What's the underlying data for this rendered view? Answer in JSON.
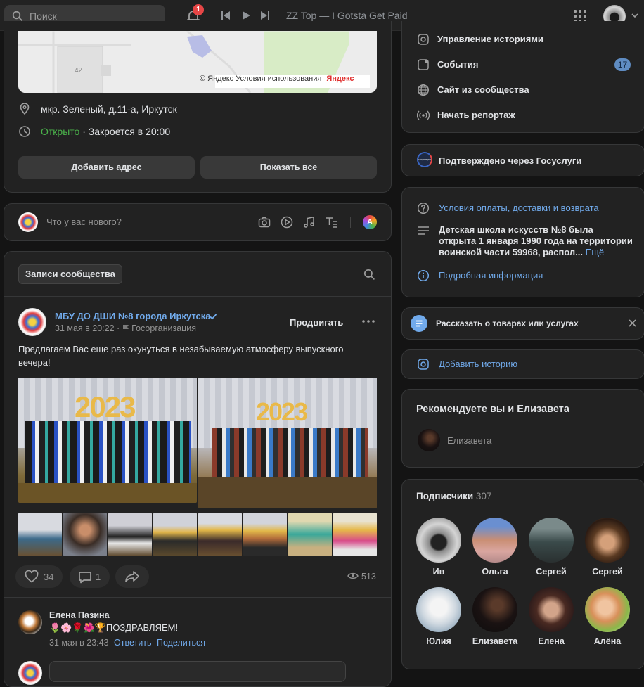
{
  "topbar": {
    "search_placeholder": "Поиск",
    "notifications_count": "1",
    "now_playing": "ZZ Top — I Gotsta Get Paid"
  },
  "map": {
    "house_number": "42",
    "copyright": "© Яндекс",
    "terms_link": "Условия использования",
    "brand": "Яндекс"
  },
  "info": {
    "address": "мкр. Зеленый, д.11-а, Иркутск",
    "open_status": "Открыто",
    "closes": " · Закроется в 20:00",
    "add_address_btn": "Добавить адрес",
    "show_all_btn": "Показать все"
  },
  "composer": {
    "placeholder": "Что у вас нового?"
  },
  "wall": {
    "tab_label": "Записи сообщества"
  },
  "post": {
    "author": "МБУ ДО ДШИ №8 города Иркутска",
    "date": "31 мая в 20:22",
    "author_type": "Госорганизация",
    "promote_btn": "Продвигать",
    "text": "Предлагаем Вас еще раз окунуться в незабываемую атмосферу выпускного вечера!",
    "photo_caption": "2023",
    "likes": "34",
    "comments": "1",
    "views": "513"
  },
  "comment": {
    "author": "Елена Пазина",
    "text": "🌷🌸🌹🌺🏆ПОЗДРАВЛЯЕМ!",
    "date": "31 мая в 23:43",
    "reply": "Ответить",
    "share": "Поделиться"
  },
  "side_menu": {
    "items": [
      {
        "label": "Управление историями",
        "icon": "stories-icon"
      },
      {
        "label": "События",
        "icon": "events-icon",
        "count": "17"
      },
      {
        "label": "Сайт из сообщества",
        "icon": "globe-icon"
      },
      {
        "label": "Начать репортаж",
        "icon": "broadcast-icon"
      }
    ]
  },
  "gosuslugi": {
    "logo_text": "госуслуги",
    "label": "Подтверждено через Госуслуги"
  },
  "about": {
    "terms_link": "Условия оплаты, доставки и возврата",
    "description": "Детская школа искусств №8 была открыта 1 января 1990 года на территории воинской части 59968, распол...",
    "more": "Ещё",
    "details_link": "Подробная информация"
  },
  "promo": {
    "label": "Рассказать о товарах или услугах"
  },
  "add_story": {
    "label": "Добавить историю"
  },
  "recommend": {
    "title": "Рекомендуете вы и Елизавета",
    "name": "Елизавета"
  },
  "subscribers": {
    "title": "Подписчики",
    "count": "307",
    "people": [
      {
        "name": "Ив"
      },
      {
        "name": "Ольга"
      },
      {
        "name": "Сергей"
      },
      {
        "name": "Сергей"
      },
      {
        "name": "Юлия"
      },
      {
        "name": "Елизавета"
      },
      {
        "name": "Елена"
      },
      {
        "name": "Алёна"
      }
    ]
  },
  "colors": {
    "accent": "#71aaeb",
    "background": "#141414",
    "card": "#222222",
    "open_green": "#4bb34b",
    "badge_red": "#e64646"
  }
}
